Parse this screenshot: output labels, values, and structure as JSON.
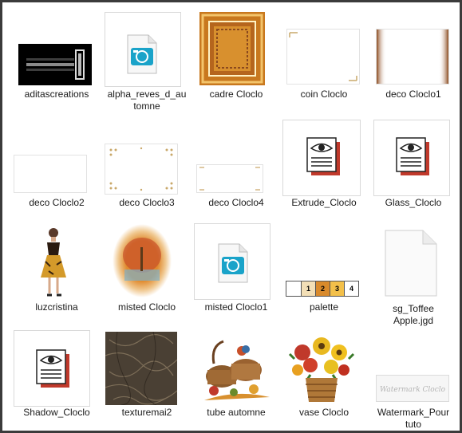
{
  "files": [
    {
      "name": "aditascreations"
    },
    {
      "name": "alpha_reves_d_au",
      "name2": "tomne"
    },
    {
      "name": "cadre Cloclo"
    },
    {
      "name": "coin Cloclo"
    },
    {
      "name": "deco Cloclo1"
    },
    {
      "name": "deco Cloclo2"
    },
    {
      "name": "deco Cloclo3"
    },
    {
      "name": "deco Cloclo4"
    },
    {
      "name": "Extrude_Cloclo"
    },
    {
      "name": "Glass_Cloclo"
    },
    {
      "name": "luzcristina"
    },
    {
      "name": "misted Cloclo"
    },
    {
      "name": "misted Cloclo1"
    },
    {
      "name": "palette",
      "swatches": [
        "1",
        "2",
        "3",
        "4"
      ]
    },
    {
      "name": "sg_Toffee",
      "name2": "Apple.jgd"
    },
    {
      "name": "Shadow_Cloclo"
    },
    {
      "name": "texturemai2"
    },
    {
      "name": "tube automne"
    },
    {
      "name": "vase Cloclo"
    },
    {
      "name": "Watermark_Pour",
      "name2": "tuto",
      "watermark_text": "Watermark Cloclo"
    }
  ],
  "colors": {
    "border": "#3b3b3b",
    "autumn_orange": "#c8781e",
    "brown": "#8b4a1e",
    "photo_cyan": "#1aa3c9",
    "plugin_red": "#c0392b"
  }
}
